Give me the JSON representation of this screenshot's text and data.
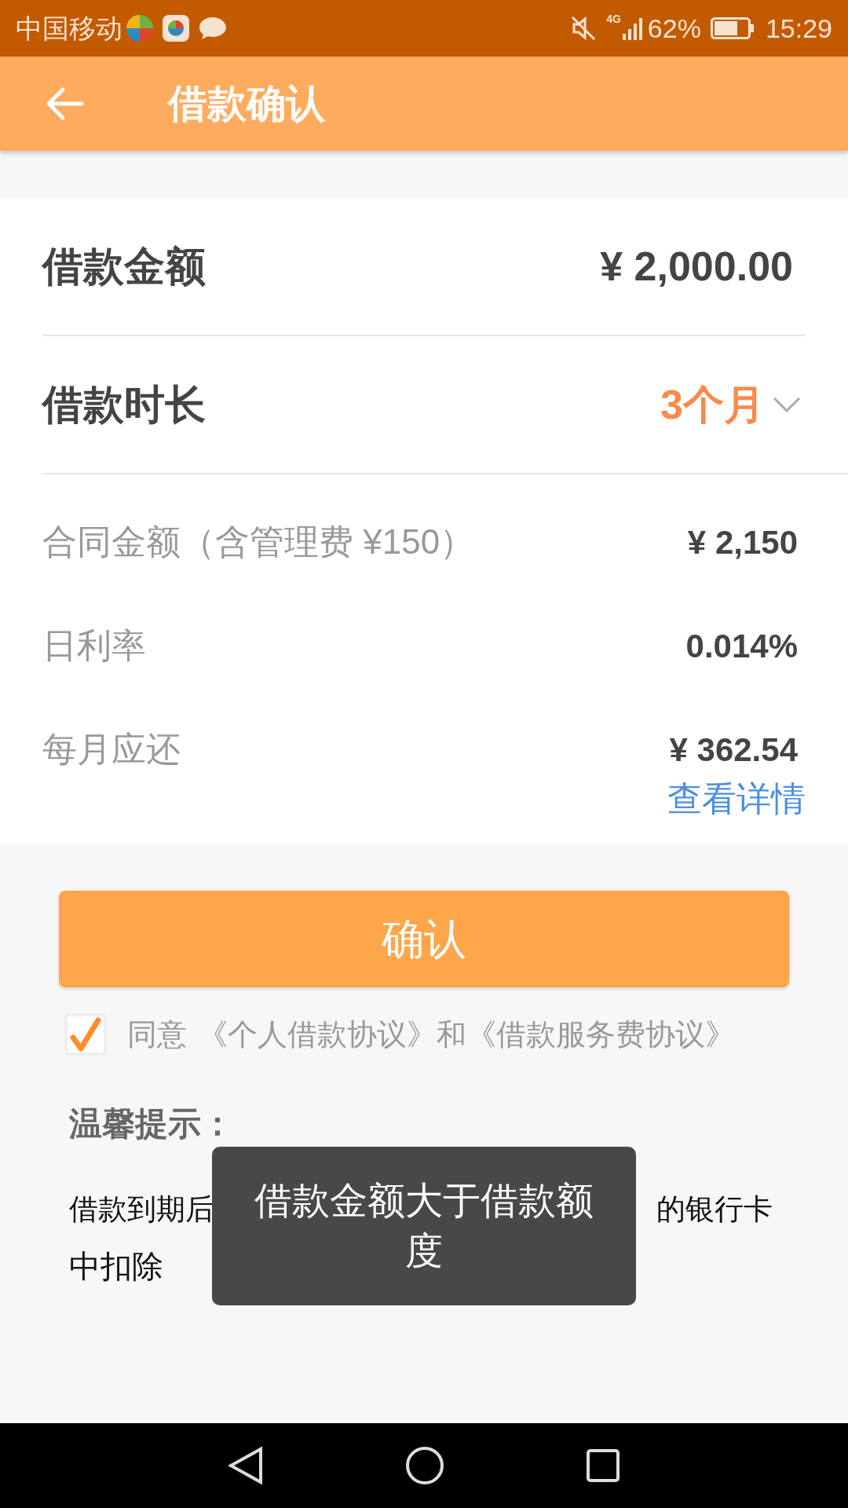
{
  "status_bar": {
    "carrier": "中国移动",
    "network": "4G",
    "battery": "62%",
    "time": "15:29"
  },
  "header": {
    "title": "借款确认"
  },
  "loan": {
    "amount_label": "借款金额",
    "amount": "¥ 2,000.00",
    "term_label": "借款时长",
    "term": "3个月"
  },
  "details": [
    {
      "label": "合同金额（含管理费 ¥150）",
      "value": "¥ 2,150"
    },
    {
      "label": "日利率",
      "value": "0.014%"
    },
    {
      "label": "每月应还",
      "value": "¥ 362.54"
    }
  ],
  "details_link": "查看详情",
  "confirm_button": "确认",
  "agreement": {
    "checked": true,
    "prefix": "同意",
    "links": [
      "《个人借款协议》",
      "和",
      "《借款服务费协议》"
    ]
  },
  "tips": {
    "title": "温馨提示：",
    "line_1_start": "借款到期后",
    "line_1_end": "的银行卡",
    "line_2": "中扣除"
  },
  "toast": "借款金额大于借款额度"
}
